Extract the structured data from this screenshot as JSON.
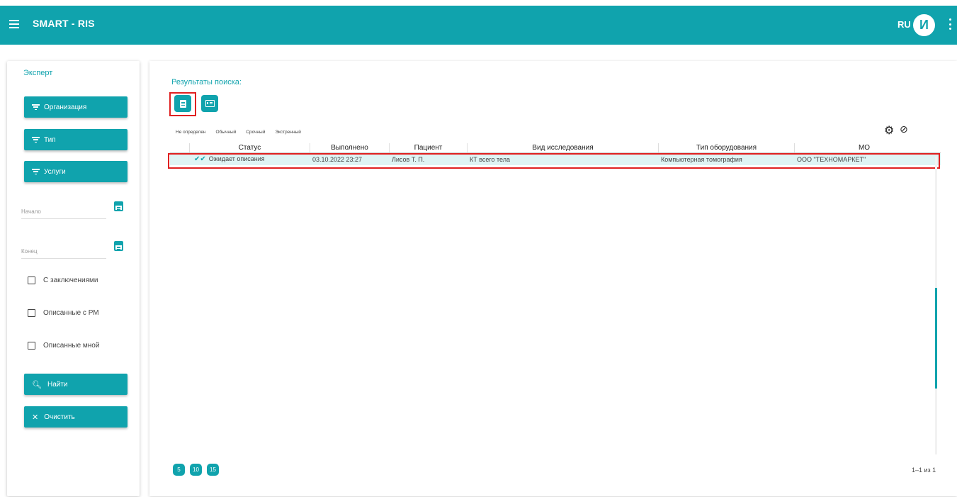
{
  "app": {
    "title": "SMART - RIS",
    "language": "RU",
    "avatar_initial": "И",
    "accent_color": "#10a3ad"
  },
  "sidebar": {
    "title": "Эксперт",
    "filters": [
      {
        "label": "Организация",
        "icon": "filter-icon"
      },
      {
        "label": "Тип",
        "icon": "filter-icon"
      },
      {
        "label": "Услуги",
        "icon": "filter-icon"
      }
    ],
    "date_from": {
      "label": "Начало",
      "icon": "calendar-icon"
    },
    "date_to": {
      "label": "Конец",
      "icon": "calendar-icon"
    },
    "checkboxes": [
      {
        "label": "С заключениями",
        "checked": false
      },
      {
        "label": "Описанные с РМ",
        "checked": false
      },
      {
        "label": "Описанные мной",
        "checked": false
      }
    ],
    "search_button": {
      "label": "Найти",
      "icon": "search-icon"
    },
    "clear_button": {
      "label": "Очистить",
      "icon": "close-icon"
    }
  },
  "main": {
    "results_label": "Результаты поиска:",
    "view_buttons": [
      {
        "name": "list-view",
        "icon": "document-icon",
        "highlighted": true
      },
      {
        "name": "card-view",
        "icon": "card-icon",
        "highlighted": false
      }
    ],
    "priority_tabs": [
      "Не определен",
      "Обычный",
      "Срочный",
      "Экстренный"
    ],
    "table": {
      "columns": [
        "Статус",
        "Выполнено",
        "Пациент",
        "Вид исследования",
        "Тип оборудования",
        "МО"
      ],
      "sorted_column": "Пациент",
      "rows": [
        {
          "status": "Ожидает описания",
          "completed": "03.10.2022 23:27",
          "patient": "Лисов Т. П.",
          "study": "КТ всего тела",
          "equipment": "Компьютерная томография",
          "org": "ООО \"ТЕХНОМАРКЕТ\"",
          "highlighted": true
        }
      ]
    },
    "page_sizes": [
      "5",
      "10",
      "15"
    ],
    "pagination_info": "1–1 из 1"
  }
}
